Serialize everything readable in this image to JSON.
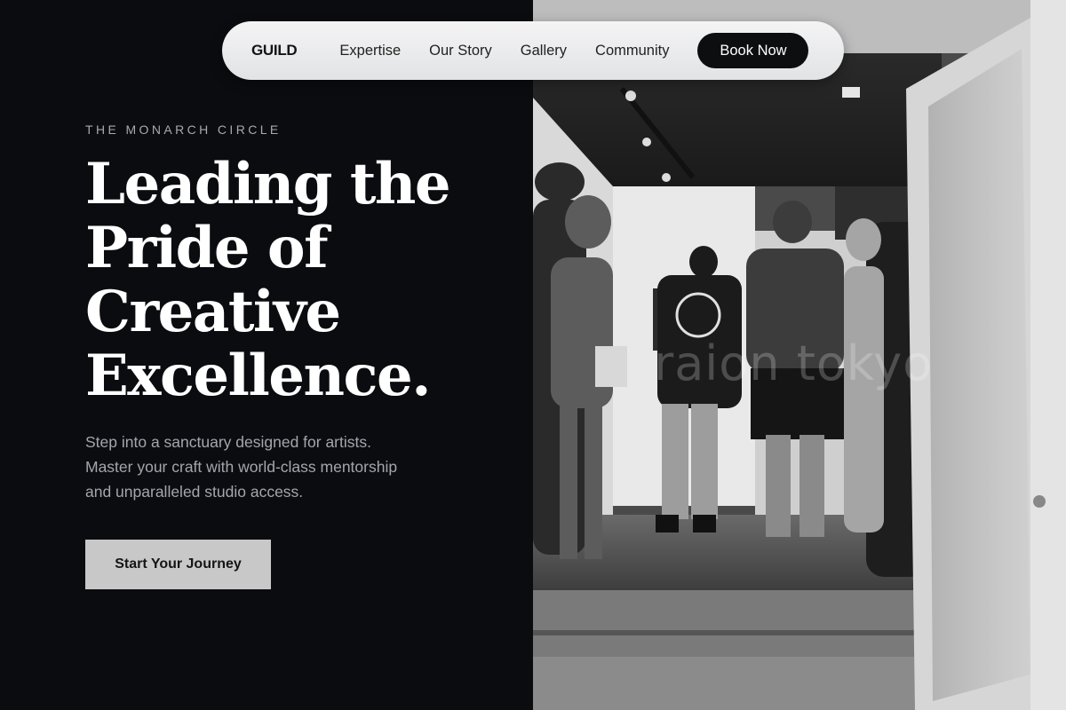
{
  "nav": {
    "brand": "GUILD",
    "links": [
      "Expertise",
      "Our Story",
      "Gallery",
      "Community"
    ],
    "cta_label": "Book Now"
  },
  "hero": {
    "eyebrow": "THE MONARCH CIRCLE",
    "headline_lines": [
      "Leading the",
      "Pride of",
      "Creative",
      "Excellence."
    ],
    "subtext_lines": [
      "Step into a sanctuary designed for artists.",
      "Master your craft with world-class mentorship",
      "and unparalleled studio access."
    ],
    "cta_label": "Start Your Journey"
  },
  "image": {
    "description_icon": "gallery-photo",
    "watermark": "raion tokyo"
  },
  "colors": {
    "background": "#0b0c10",
    "nav_bg": "#ededee",
    "book_button": "#0d0e10",
    "cta_button": "#c8c8c8"
  }
}
